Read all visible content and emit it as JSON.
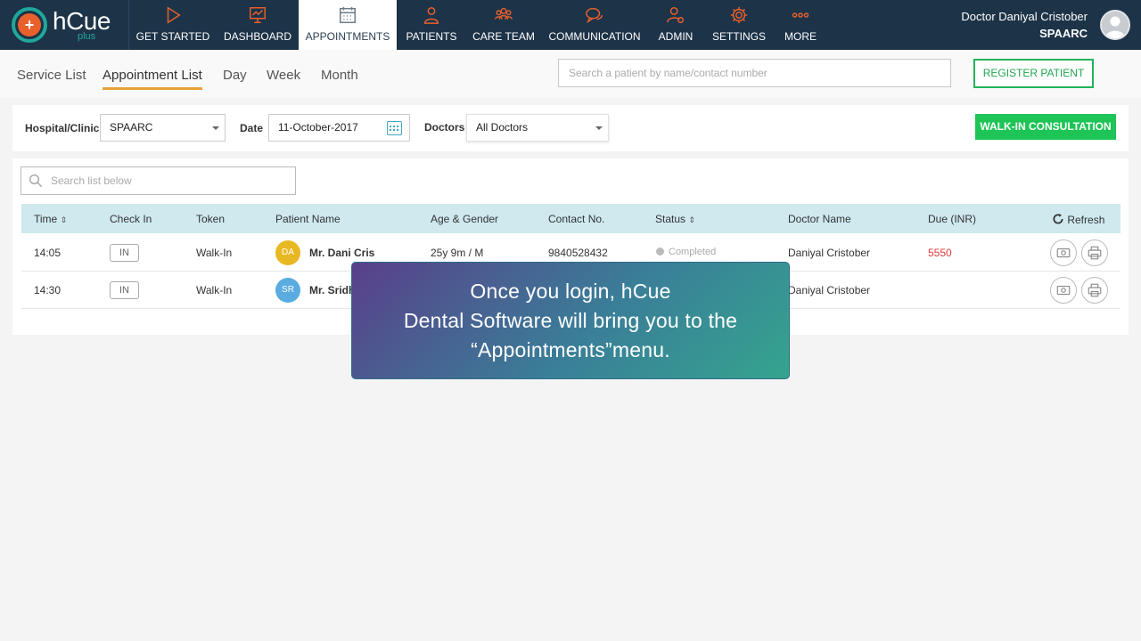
{
  "app": {
    "logo_text": "hCue",
    "logo_sub": "plus"
  },
  "nav": {
    "items": [
      {
        "label": "GET STARTED",
        "icon": "play-icon"
      },
      {
        "label": "DASHBOARD",
        "icon": "presentation-icon"
      },
      {
        "label": "APPOINTMENTS",
        "icon": "calendar-icon",
        "active": true
      },
      {
        "label": "PATIENTS",
        "icon": "person-icon"
      },
      {
        "label": "CARE TEAM",
        "icon": "team-icon"
      },
      {
        "label": "COMMUNICATION",
        "icon": "chat-icon"
      },
      {
        "label": "ADMIN",
        "icon": "admin-icon"
      },
      {
        "label": "SETTINGS",
        "icon": "gear-icon"
      },
      {
        "label": "MORE",
        "icon": "more-icon"
      }
    ]
  },
  "user": {
    "name": "Doctor Daniyal Cristober",
    "clinic": "SPAARC"
  },
  "tabs": [
    "Service List",
    "Appointment List",
    "Day",
    "Week",
    "Month"
  ],
  "active_tab": "Appointment List",
  "search": {
    "placeholder": "Search a patient by name/contact number"
  },
  "register_label": "REGISTER PATIENT",
  "filters": {
    "hospital_label": "Hospital/Clinic",
    "hospital_value": "SPAARC",
    "date_label": "Date",
    "date_value": "11-October-2017",
    "doctors_label": "Doctors",
    "doctors_value": "All Doctors",
    "walkin_label": "WALK-IN CONSULTATION"
  },
  "list": {
    "search_placeholder": "Search list below",
    "columns": {
      "time": "Time",
      "checkin": "Check In",
      "token": "Token",
      "patient": "Patient Name",
      "age": "Age & Gender",
      "contact": "Contact No.",
      "status": "Status",
      "doctor": "Doctor Name",
      "due": "Due (INR)",
      "refresh": "Refresh"
    },
    "rows": [
      {
        "time": "14:05",
        "checkin": "IN",
        "token": "Walk-In",
        "initials": "DA",
        "initials_color": "#e8b822",
        "name": "Mr. Dani Cris",
        "age": "25y 9m / M",
        "contact": "9840528432",
        "status": "Completed",
        "doctor": "Daniyal Cristober",
        "due": "5550"
      },
      {
        "time": "14:30",
        "checkin": "IN",
        "token": "Walk-In",
        "initials": "SR",
        "initials_color": "#5aace0",
        "name": "Mr. Sridh",
        "age": "",
        "contact": "",
        "status": "",
        "doctor": "Daniyal Cristober",
        "due": ""
      }
    ]
  },
  "caption": {
    "line1": "Once you login, hCue",
    "line2": "Dental Software will bring you to the",
    "line3": "“Appointments”menu."
  },
  "colors": {
    "nav_bg": "#1d3348",
    "accent_orange": "#e8602c",
    "accent_green": "#1ec456",
    "table_header": "#cfe9ef",
    "due_red": "#e03a3a"
  }
}
